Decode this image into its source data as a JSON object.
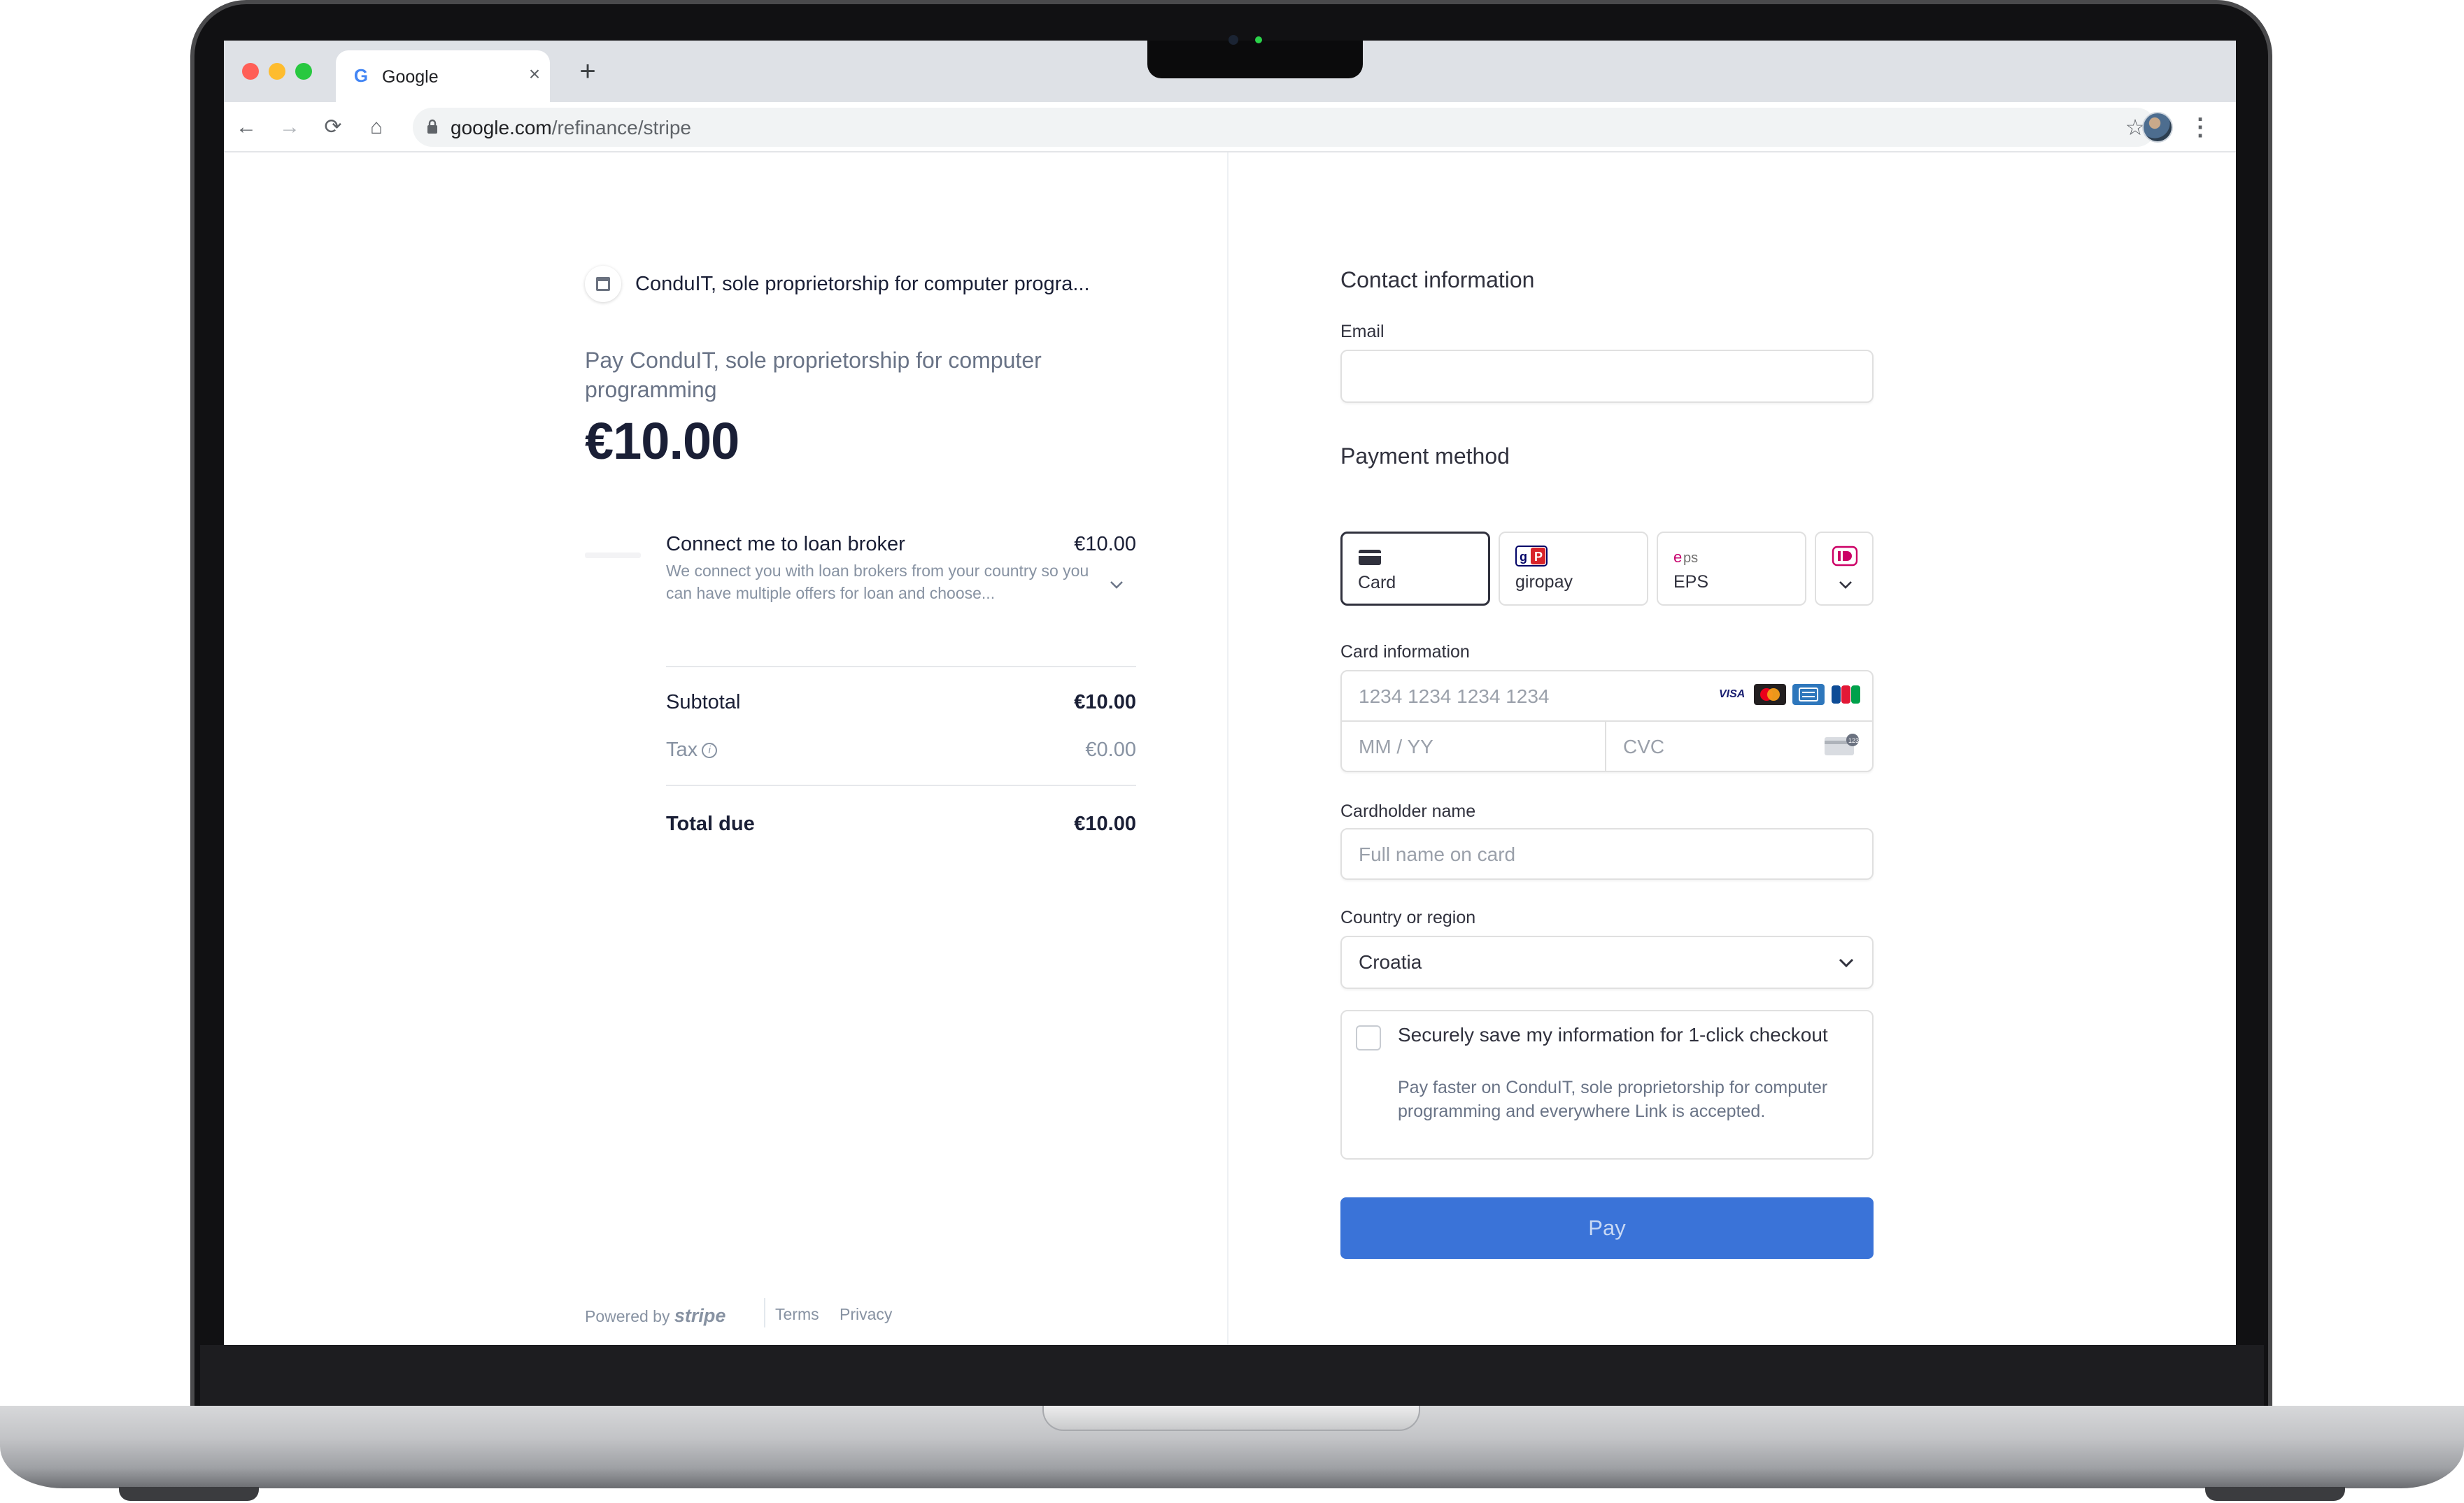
{
  "browser": {
    "tab_title": "Google",
    "tab_favicon": "G",
    "url_host": "google.com",
    "url_path": "/refinance/stripe",
    "icons": [
      "back-icon",
      "forward-icon",
      "reload-icon",
      "home-icon",
      "lock-icon",
      "star-icon",
      "kebab-icon",
      "close-icon",
      "plus-icon"
    ]
  },
  "summary": {
    "merchant_name": "ConduIT, sole proprietorship for computer progra...",
    "pay_to": "Pay ConduIT, sole proprietorship for computer programming",
    "amount": "€10.00",
    "item": {
      "name": "Connect me to loan broker",
      "price": "€10.00",
      "description": "We connect you with loan brokers from your country so you can have multiple offers for loan and choose..."
    },
    "subtotal_label": "Subtotal",
    "subtotal_value": "€10.00",
    "tax_label": "Tax",
    "tax_value": "€0.00",
    "total_label": "Total due",
    "total_value": "€10.00"
  },
  "footer": {
    "powered_by": "Powered by",
    "stripe": "stripe",
    "terms": "Terms",
    "privacy": "Privacy"
  },
  "form": {
    "contact_title": "Contact information",
    "email_label": "Email",
    "email_value": "",
    "payment_title": "Payment method",
    "methods": [
      {
        "label": "Card",
        "selected": true
      },
      {
        "label": "giropay",
        "selected": false
      },
      {
        "label": "EPS",
        "selected": false
      }
    ],
    "card_label": "Card information",
    "card_number_placeholder": "1234 1234 1234 1234",
    "card_brands": [
      "VISA",
      "mastercard",
      "amex",
      "JCB"
    ],
    "expiry_placeholder": "MM / YY",
    "cvc_placeholder": "CVC",
    "cardholder_label": "Cardholder name",
    "cardholder_placeholder": "Full name on card",
    "country_label": "Country or region",
    "country_value": "Croatia",
    "save_title": "Securely save my information for 1-click checkout",
    "save_desc": "Pay faster on ConduIT, sole proprietorship for computer programming and everywhere Link is accepted.",
    "pay_label": "Pay"
  },
  "colors": {
    "pay_button": "#3a73d8",
    "text_primary": "#1a1f36",
    "text_muted": "#697386"
  }
}
